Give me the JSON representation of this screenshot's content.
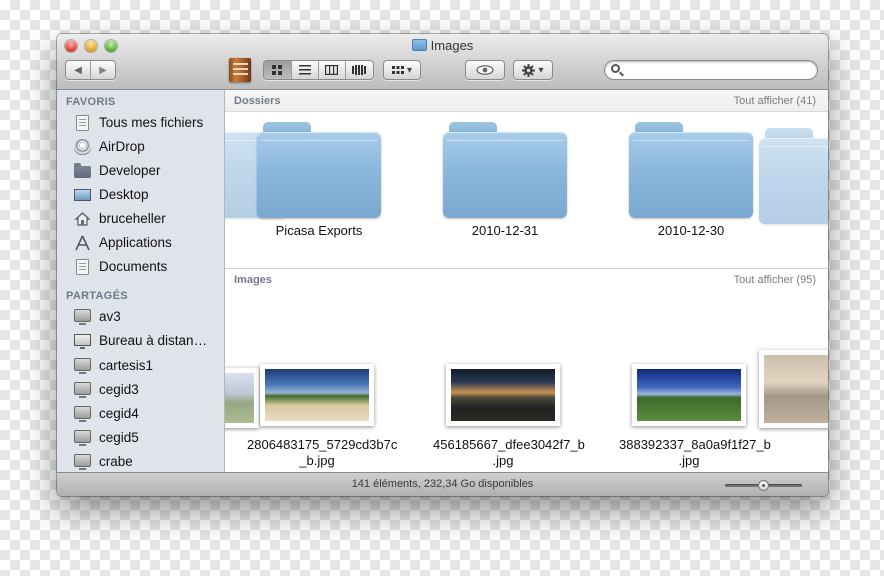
{
  "window": {
    "title": "Images"
  },
  "toolbar": {
    "back_glyph": "◀",
    "forward_glyph": "▶",
    "view_modes": [
      "icon-view",
      "list-view",
      "column-view",
      "coverflow-view"
    ],
    "active_view": "icon-view",
    "arrange_glyph": "▾",
    "action_glyph": "▾",
    "quicklook_glyph": "👁",
    "search": {
      "value": "",
      "placeholder": ""
    }
  },
  "sidebar": {
    "favorites_header": "FAVORIS",
    "favorites": [
      {
        "label": "Tous mes fichiers",
        "icon": "all-files-icon"
      },
      {
        "label": "AirDrop",
        "icon": "airdrop-icon"
      },
      {
        "label": "Developer",
        "icon": "folder-icon"
      },
      {
        "label": "Desktop",
        "icon": "desktop-icon"
      },
      {
        "label": "bruceheller",
        "icon": "home-icon"
      },
      {
        "label": "Applications",
        "icon": "applications-icon"
      },
      {
        "label": "Documents",
        "icon": "documents-icon"
      }
    ],
    "shared_header": "PARTAGÉS",
    "shared": [
      {
        "label": "av3",
        "icon": "monitor-icon"
      },
      {
        "label": "Bureau à distan…",
        "icon": "remote-display-icon"
      },
      {
        "label": "cartesis1",
        "icon": "monitor-icon"
      },
      {
        "label": "cegid3",
        "icon": "monitor-icon"
      },
      {
        "label": "cegid4",
        "icon": "monitor-icon"
      },
      {
        "label": "cegid5",
        "icon": "monitor-icon"
      },
      {
        "label": "crabe",
        "icon": "monitor-icon"
      }
    ]
  },
  "sections": {
    "folders": {
      "header": "Dossiers",
      "show_all": "Tout afficher (41)",
      "items": [
        "Picasa Exports",
        "2010-12-31",
        "2010-12-30"
      ]
    },
    "images": {
      "header": "Images",
      "show_all": "Tout afficher (95)",
      "items": [
        {
          "line1": "2806483175_5729cd3b7c",
          "line2": "_b.jpg"
        },
        {
          "line1": "456185667_dfee3042f7_b",
          "line2": ".jpg"
        },
        {
          "line1": "388392337_8a0a9f1f27_b",
          "line2": ".jpg"
        }
      ]
    }
  },
  "status": {
    "text": "141 éléments, 232,34 Go disponibles",
    "icon_size_fraction": 0.5
  },
  "colors": {
    "sidebar_bg": "#dfe4ea",
    "sidebar_header": "#6f7a86",
    "folder_blue": "#8bb7dc"
  }
}
